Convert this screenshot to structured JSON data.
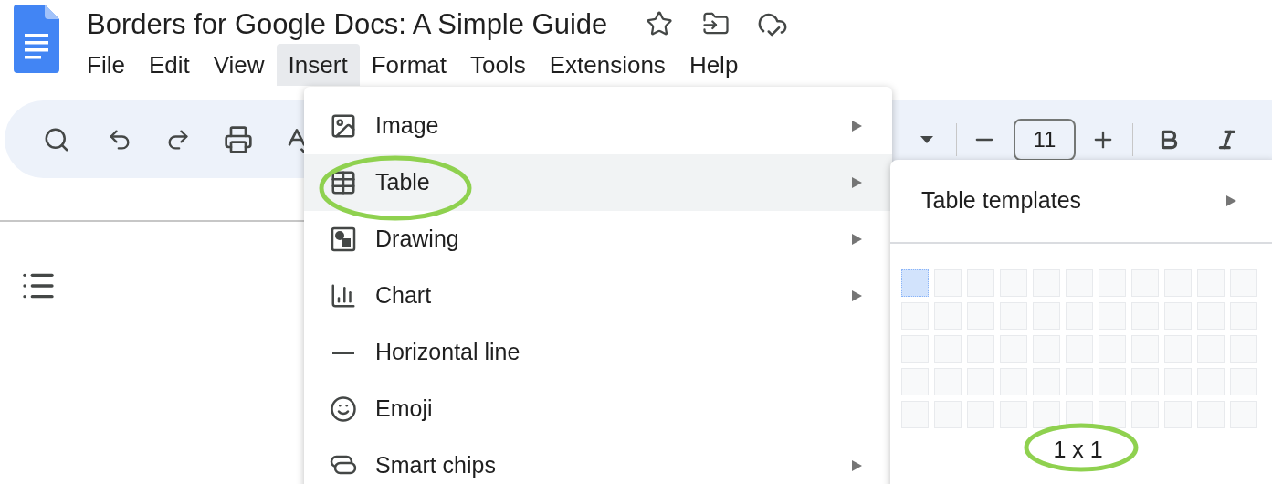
{
  "document": {
    "title": "Borders for Google Docs: A Simple Guide"
  },
  "menu_bar": [
    {
      "label": "File",
      "selected": false
    },
    {
      "label": "Edit",
      "selected": false
    },
    {
      "label": "View",
      "selected": false
    },
    {
      "label": "Insert",
      "selected": true
    },
    {
      "label": "Format",
      "selected": false
    },
    {
      "label": "Tools",
      "selected": false
    },
    {
      "label": "Extensions",
      "selected": false
    },
    {
      "label": "Help",
      "selected": false
    }
  ],
  "toolbar": {
    "font_size": "11"
  },
  "insert_menu": [
    {
      "label": "Image",
      "selected": false,
      "has_submenu": true
    },
    {
      "label": "Table",
      "selected": true,
      "has_submenu": true
    },
    {
      "label": "Drawing",
      "selected": false,
      "has_submenu": true
    },
    {
      "label": "Chart",
      "selected": false,
      "has_submenu": true
    },
    {
      "label": "Horizontal line",
      "selected": false,
      "has_submenu": false
    },
    {
      "label": "Emoji",
      "selected": false,
      "has_submenu": false
    },
    {
      "label": "Smart chips",
      "selected": false,
      "has_submenu": true
    }
  ],
  "table_submenu": {
    "templates": {
      "label": "Table templates",
      "has_submenu": true
    },
    "grid": [
      [
        {
          "selected": true
        },
        {
          "selected": false
        },
        {
          "selected": false
        },
        {
          "selected": false
        },
        {
          "selected": false
        },
        {
          "selected": false
        },
        {
          "selected": false
        },
        {
          "selected": false
        },
        {
          "selected": false
        },
        {
          "selected": false
        },
        {
          "selected": false
        }
      ],
      [
        {
          "selected": false
        },
        {
          "selected": false
        },
        {
          "selected": false
        },
        {
          "selected": false
        },
        {
          "selected": false
        },
        {
          "selected": false
        },
        {
          "selected": false
        },
        {
          "selected": false
        },
        {
          "selected": false
        },
        {
          "selected": false
        },
        {
          "selected": false
        }
      ],
      [
        {
          "selected": false
        },
        {
          "selected": false
        },
        {
          "selected": false
        },
        {
          "selected": false
        },
        {
          "selected": false
        },
        {
          "selected": false
        },
        {
          "selected": false
        },
        {
          "selected": false
        },
        {
          "selected": false
        },
        {
          "selected": false
        },
        {
          "selected": false
        }
      ],
      [
        {
          "selected": false
        },
        {
          "selected": false
        },
        {
          "selected": false
        },
        {
          "selected": false
        },
        {
          "selected": false
        },
        {
          "selected": false
        },
        {
          "selected": false
        },
        {
          "selected": false
        },
        {
          "selected": false
        },
        {
          "selected": false
        },
        {
          "selected": false
        }
      ],
      [
        {
          "selected": false
        },
        {
          "selected": false
        },
        {
          "selected": false
        },
        {
          "selected": false
        },
        {
          "selected": false
        },
        {
          "selected": false
        },
        {
          "selected": false
        },
        {
          "selected": false
        },
        {
          "selected": false
        },
        {
          "selected": false
        },
        {
          "selected": false
        }
      ]
    ],
    "size_label": "1 x 1"
  }
}
